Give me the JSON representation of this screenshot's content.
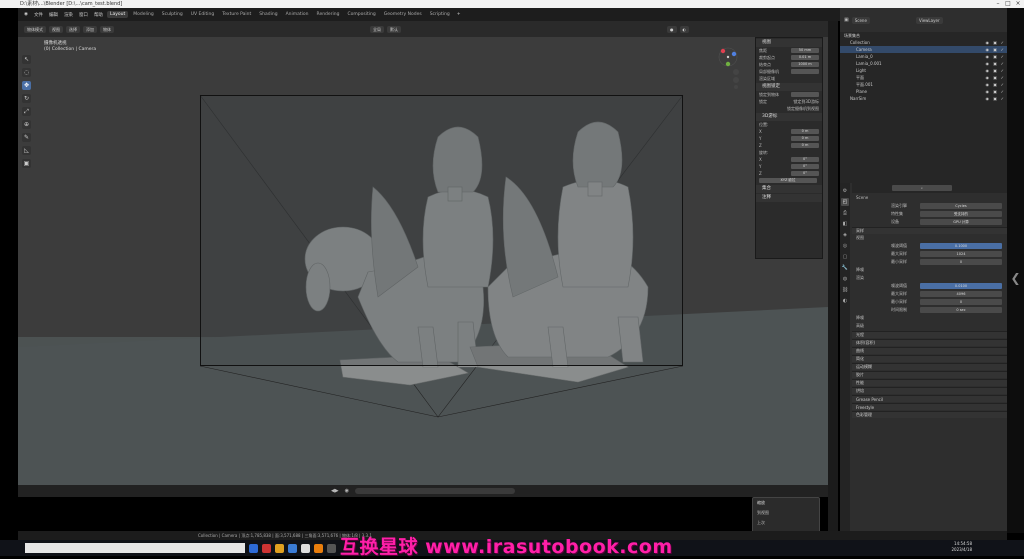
{
  "window": {
    "title": "D:\\素材\\...\\Blender [D:\\...\\cam_test.blend]"
  },
  "menus": [
    "文件",
    "编辑",
    "渲染",
    "窗口",
    "帮助"
  ],
  "workspaces": [
    {
      "label": "Layout",
      "active": true
    },
    {
      "label": "Modeling",
      "active": false
    },
    {
      "label": "Sculpting",
      "active": false
    },
    {
      "label": "UV Editing",
      "active": false
    },
    {
      "label": "Texture Paint",
      "active": false
    },
    {
      "label": "Shading",
      "active": false
    },
    {
      "label": "Animation",
      "active": false
    },
    {
      "label": "Rendering",
      "active": false
    },
    {
      "label": "Compositing",
      "active": false
    },
    {
      "label": "Geometry Nodes",
      "active": false
    },
    {
      "label": "Scripting",
      "active": false
    }
  ],
  "toolbar": {
    "mode": "物体模式",
    "view": "视图",
    "select": "选择",
    "add": "添加",
    "object": "物体",
    "transform": "全局",
    "pivot": "默认"
  },
  "viewport": {
    "line1": "摄像机透视",
    "line2": "(0) Collection | Camera"
  },
  "tools": [
    "cursor-tool-icon",
    "select-icon",
    "move-icon",
    "rotate-icon",
    "scale-icon",
    "transform-icon",
    "annotate-icon",
    "measure-icon",
    "add-cube-icon"
  ],
  "npanel": {
    "view_header": "视图",
    "focal_label": "焦距",
    "focal_value": "50 mm",
    "clip_start_label": "裁剪起点",
    "clip_start_value": "0.01 m",
    "clip_end_label": "结束点",
    "clip_end_value": "1000 m",
    "local_camera_label": "局部摄像机",
    "render_region_label": "渲染区域",
    "view_lock_header": "视图锁定",
    "lock_to_object_label": "锁定到物体",
    "lock_label": "锁定",
    "lock_cursor_label": "锁定到3D游标",
    "lock_camera_label": "锁定摄像机到视图",
    "cursor_header": "3D游标",
    "location_label": "位置:",
    "x_label": "X",
    "x_value": "0 m",
    "y_label": "Y",
    "y_value": "0 m",
    "z_label": "Z",
    "z_value": "0 m",
    "rotation_label": "旋转:",
    "rx_value": "0°",
    "ry_value": "0°",
    "rz_value": "0°",
    "rotation_mode": "XYZ 欧拉",
    "collections_header": "集合",
    "annotations_header": "注释"
  },
  "outliner": {
    "scene_label": "Scene",
    "viewlayer_label": "ViewLayer",
    "items": [
      {
        "label": "场景集合",
        "indent": 0
      },
      {
        "label": "Collection",
        "indent": 1
      },
      {
        "label": "Camera",
        "indent": 2
      },
      {
        "label": "Lamia_0",
        "indent": 2
      },
      {
        "label": "Lamia_0.001",
        "indent": 2
      },
      {
        "label": "Light",
        "indent": 2
      },
      {
        "label": "平面",
        "indent": 2
      },
      {
        "label": "平面.001",
        "indent": 2
      },
      {
        "label": "Plane",
        "indent": 2
      },
      {
        "label": "NarrSim",
        "indent": 1
      }
    ]
  },
  "properties": {
    "search_placeholder": "",
    "scene_name": "Scene",
    "engine_label": "渲染引擎",
    "engine_value": "Cycles",
    "feature_label": "特性集",
    "feature_value": "受支持的",
    "device_label": "设备",
    "device_value": "GPU 计算",
    "sampling_header": "采样",
    "viewport_header": "视图",
    "noise_threshold_label": "噪波阈值",
    "noise_threshold_value": "0.1000",
    "max_samples_label": "最大采样",
    "max_samples_value": "1024",
    "min_samples_label": "最小采样",
    "min_samples_value": "0",
    "denoise_label": "降噪",
    "render_header": "渲染",
    "r_noise_value": "0.0100",
    "r_max_samples_value": "4096",
    "r_min_samples_value": "0",
    "time_limit_label": "时间限制",
    "time_limit_value": "0 sec",
    "r_denoise_label": "降噪",
    "advanced_label": "高级",
    "sections": [
      "光程",
      "体积(容积)",
      "曲线",
      "简化",
      "运动模糊",
      "胶片",
      "性能",
      "烘焙",
      "Grease Pencil",
      "Freestyle",
      "色彩管理"
    ]
  },
  "popup": {
    "header": "缩放",
    "row1": "到视图",
    "row2": "上次"
  },
  "statusbar": {
    "text": "Collection | Camera | 顶点:1,785,838 | 面:3,571,688 | 三角面:3,571,676 | 物体:1/8 | 3.3.1"
  },
  "taskbar": {
    "time": "14:54:58",
    "date": "2023/4/18"
  },
  "watermark": "互换星球 www.irasutobook.com"
}
